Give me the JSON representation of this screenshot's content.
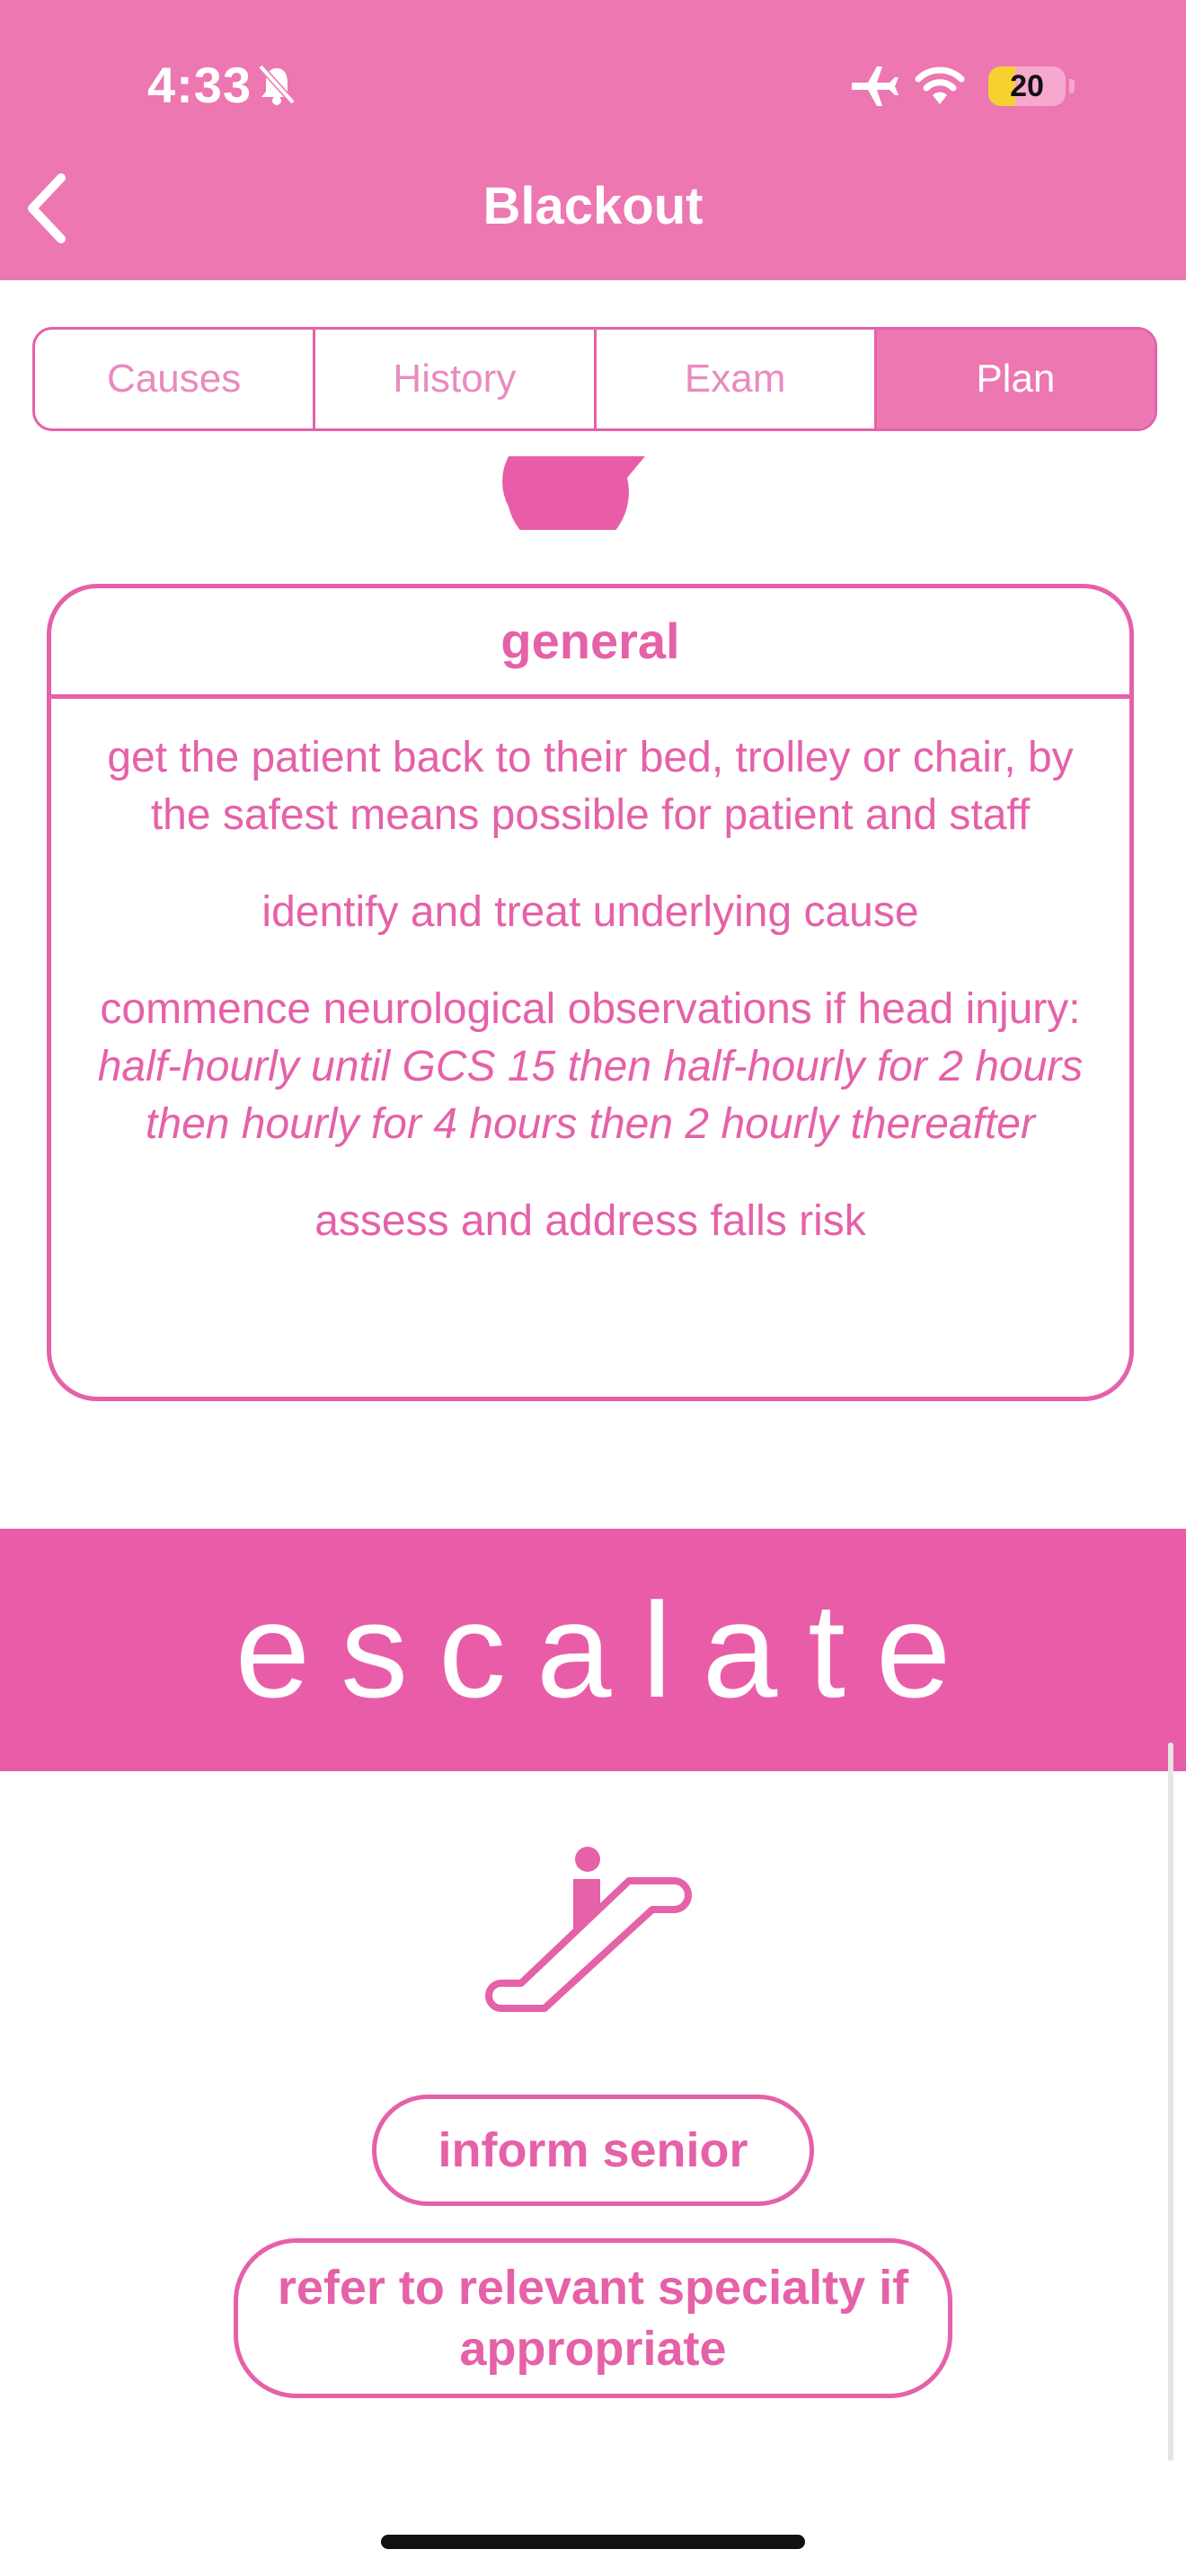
{
  "status_bar": {
    "time": "4:33",
    "battery": "20"
  },
  "header": {
    "title": "Blackout"
  },
  "tabs": [
    "Causes",
    "History",
    "Exam",
    "Plan"
  ],
  "selected_tab": "Plan",
  "general_card": {
    "title": "general",
    "items": [
      "get the patient back to their bed, trolley or chair, by the safest means possible for patient and staff",
      "identify and treat underlying cause",
      "commence neurological observations if head injury:",
      "assess and address falls risk"
    ],
    "neuro_obs_detail": "half-hourly until GCS 15 then half-hourly for 2 hours then hourly for 4 hours then 2 hourly thereafter"
  },
  "escalate": {
    "heading": "escalate",
    "buttons": [
      "inform senior",
      "refer to relevant specialty if appropriate"
    ]
  },
  "colors": {
    "header": "#EC77B1",
    "accent": "#E561A8",
    "band": "#E95DA8"
  },
  "icons": [
    "bell-slash-icon",
    "airplane-icon",
    "wifi-icon",
    "battery-icon",
    "back-chevron-icon",
    "droplet-icon",
    "escalator-icon"
  ]
}
